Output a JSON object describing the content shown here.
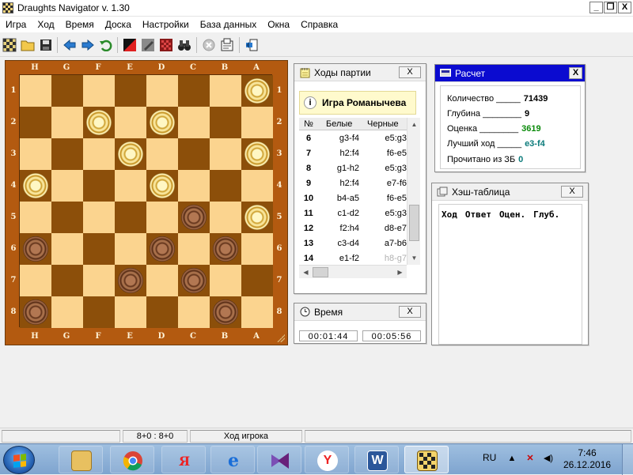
{
  "window": {
    "title": "Draughts Navigator v. 1.30",
    "minimize": "_",
    "restore": "❐",
    "close": "X"
  },
  "menu": [
    "Игра",
    "Ход",
    "Время",
    "Доска",
    "Настройки",
    "База данных",
    "Окна",
    "Справка"
  ],
  "board": {
    "files": [
      "H",
      "G",
      "F",
      "E",
      "D",
      "C",
      "B",
      "A"
    ],
    "ranks": [
      "1",
      "2",
      "3",
      "4",
      "5",
      "6",
      "7",
      "8"
    ],
    "colors": {
      "light": "#fbd48f",
      "dark": "#8c4f0a",
      "frame": "#b35a10"
    },
    "pieces": {
      "white": [
        "a1",
        "f2",
        "d2",
        "e3",
        "a3",
        "h4",
        "d4",
        "a5"
      ],
      "black": [
        "c5",
        "h6",
        "d6",
        "b6",
        "e7",
        "c7",
        "h8",
        "b8"
      ]
    }
  },
  "moves_panel": {
    "title": "Ходы партии",
    "close": "X",
    "game_name": "Игра Романычева",
    "columns": [
      "№",
      "Белые",
      "Черные"
    ],
    "rows": [
      {
        "n": "6",
        "w": "g3-f4",
        "b": "e5:g3"
      },
      {
        "n": "7",
        "w": "h2:f4",
        "b": "f6-e5"
      },
      {
        "n": "8",
        "w": "g1-h2",
        "b": "e5:g3"
      },
      {
        "n": "9",
        "w": "h2:f4",
        "b": "e7-f6"
      },
      {
        "n": "10",
        "w": "b4-a5",
        "b": "f6-e5"
      },
      {
        "n": "11",
        "w": "c1-d2",
        "b": "e5:g3"
      },
      {
        "n": "12",
        "w": "f2:h4",
        "b": "d8-e7"
      },
      {
        "n": "13",
        "w": "c3-d4",
        "b": "a7-b6"
      },
      {
        "n": "14",
        "w": "e1-f2",
        "b": "h8-g7"
      }
    ]
  },
  "time_panel": {
    "title": "Время",
    "close": "X",
    "white_clock": "00:01:44",
    "black_clock": "00:05:56"
  },
  "analysis_panel": {
    "title": "Расчет",
    "close": "X",
    "rows": [
      {
        "label": "Количество _____",
        "value": "71439",
        "color": "#000000"
      },
      {
        "label": "Глубина ________",
        "value": "9",
        "color": "#000000"
      },
      {
        "label": "Оценка ________",
        "value": "3619",
        "color": "#0a8a0a"
      },
      {
        "label": "Лучший ход _____",
        "value": "e3-f4",
        "color": "#0a7a7a"
      },
      {
        "label": "Прочитано из ЗБ",
        "value": "0",
        "color": "#0a7a7a"
      }
    ]
  },
  "hash_panel": {
    "title": "Хэш-таблица",
    "close": "X",
    "columns": [
      "Ход",
      "Ответ",
      "Оцен.",
      "Глуб."
    ]
  },
  "statusbar": {
    "score": "8+0 : 8+0",
    "turn": "Ход игрока"
  },
  "taskbar": {
    "apps": [
      "file-explorer",
      "chrome",
      "yandex-browser",
      "internet-explorer",
      "visual-studio",
      "yandex",
      "word",
      "draughts-navigator"
    ],
    "lang": "RU",
    "time": "7:46",
    "date": "26.12.2016"
  }
}
